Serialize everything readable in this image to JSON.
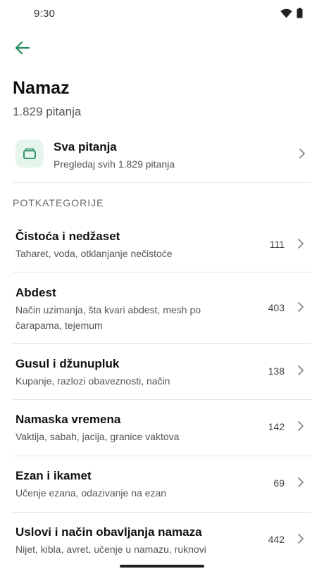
{
  "status_bar": {
    "time": "9:30",
    "wifi_icon": "wifi-icon",
    "battery_icon": "battery-icon"
  },
  "header": {
    "back_icon": "arrow-left-icon",
    "accent_color": "#1e8a5a"
  },
  "page": {
    "title": "Namaz",
    "subtitle": "1.829 pitanja"
  },
  "all_questions": {
    "title": "Sva pitanja",
    "description": "Pregledaj svih 1.829 pitanja",
    "icon": "folder-icon"
  },
  "section_label": "POTKATEGORIJE",
  "subcategories": [
    {
      "title": "Čistoća i nedžaset",
      "description": "Taharet, voda, otklanjanje nečistoće",
      "count": "111"
    },
    {
      "title": "Abdest",
      "description": "Način uzimanja, šta kvari abdest, mesh po čarapama, tejemum",
      "count": "403"
    },
    {
      "title": "Gusul i džunupluk",
      "description": "Kupanje, razlozi obaveznosti, način",
      "count": "138"
    },
    {
      "title": "Namaska vremena",
      "description": "Vaktija, sabah, jacija, granice vaktova",
      "count": "142"
    },
    {
      "title": "Ezan i ikamet",
      "description": "Učenje ezana, odazivanje na ezan",
      "count": "69"
    },
    {
      "title": "Uslovi i način obavljanja namaza",
      "description": "Nijet, kibla, avret, učenje u namazu, ruknovi",
      "count": "442"
    }
  ]
}
